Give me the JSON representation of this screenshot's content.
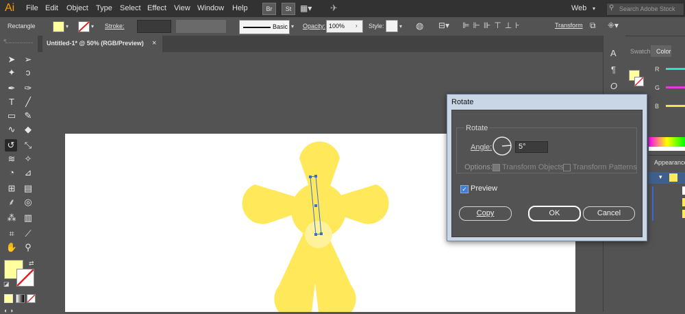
{
  "app": {
    "logo": "Ai"
  },
  "menu": [
    "File",
    "Edit",
    "Object",
    "Type",
    "Select",
    "Effect",
    "View",
    "Window",
    "Help"
  ],
  "bridge_buttons": [
    "Br",
    "St"
  ],
  "workspace": "Web",
  "search": {
    "placeholder": "Search Adobe Stock"
  },
  "control_bar": {
    "selection_label": "Rectangle",
    "stroke_label": "Stroke:",
    "brush_label": "Basic",
    "opacity_label": "Opacity:",
    "opacity_value": "100%",
    "style_label": "Style:",
    "transform_label": "Transform"
  },
  "document_tab": {
    "title": "Untitled-1* @ 50% (RGB/Preview)",
    "close": "×"
  },
  "panels": {
    "swatches_tab": "Swatch",
    "color_tab": "Color",
    "color_channels": [
      "R",
      "G",
      "B"
    ],
    "appearance_tab": "Appearance"
  },
  "dialog": {
    "title": "Rotate",
    "group_label": "Rotate",
    "angle_label": "Angle:",
    "angle_value": "5°",
    "options_label": "Options:",
    "transform_objects": "Transform Objects",
    "transform_patterns": "Transform Patterns",
    "preview_label": "Preview",
    "copy_button": "Copy",
    "ok_button": "OK",
    "cancel_button": "Cancel"
  },
  "colors": {
    "fill": "#ffffa0",
    "flower": "#ffe85a",
    "flower_center": "#fff29a",
    "ui_dark": "#323232",
    "ui_mid": "#535353",
    "accent_orange": "#ff9a00"
  }
}
